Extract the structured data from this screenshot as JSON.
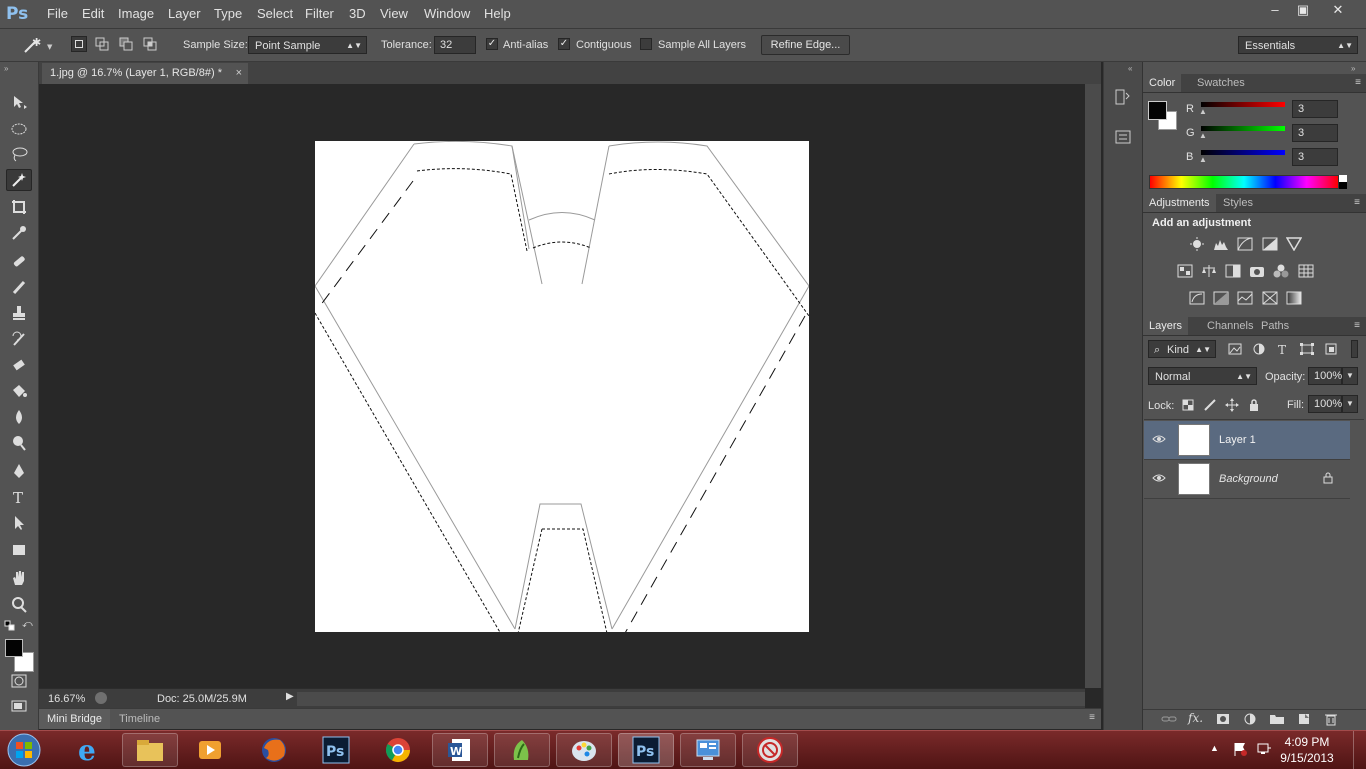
{
  "app": {
    "logo": "Ps"
  },
  "menu": {
    "items": [
      "File",
      "Edit",
      "Image",
      "Layer",
      "Type",
      "Select",
      "Filter",
      "3D",
      "View",
      "Window",
      "Help"
    ]
  },
  "window_controls": {
    "minimize": "–",
    "maximize": "▣",
    "close": "✕"
  },
  "options_bar": {
    "sample_size_label": "Sample Size:",
    "sample_size_value": "Point Sample",
    "tolerance_label": "Tolerance:",
    "tolerance_value": "32",
    "anti_alias_label": "Anti-alias",
    "anti_alias_checked": true,
    "contiguous_label": "Contiguous",
    "contiguous_checked": true,
    "sample_all_layers_label": "Sample All Layers",
    "sample_all_layers_checked": false,
    "refine_edge_label": "Refine Edge...",
    "workspace_value": "Essentials"
  },
  "document": {
    "tab_title": "1.jpg @ 16.7% (Layer 1, RGB/8#) *",
    "tab_close": "×"
  },
  "status_bar": {
    "zoom": "16.67%",
    "doc_info": "Doc: 25.0M/25.9M"
  },
  "bottom_tabs": [
    "Mini Bridge",
    "Timeline"
  ],
  "color_panel": {
    "tabs": [
      "Color",
      "Swatches"
    ],
    "channels": [
      {
        "label": "R",
        "value": "3"
      },
      {
        "label": "G",
        "value": "3"
      },
      {
        "label": "B",
        "value": "3"
      }
    ],
    "foreground": "#030303",
    "background": "#ffffff"
  },
  "adjustments_panel": {
    "tabs": [
      "Adjustments",
      "Styles"
    ],
    "heading": "Add an adjustment"
  },
  "layers_panel": {
    "tabs": [
      "Layers",
      "Channels",
      "Paths"
    ],
    "filter_kind": "Kind",
    "blend_mode": "Normal",
    "opacity_label": "Opacity:",
    "opacity_value": "100%",
    "lock_label": "Lock:",
    "fill_label": "Fill:",
    "fill_value": "100%",
    "layers": [
      {
        "name": "Layer 1",
        "selected": true
      },
      {
        "name": "Background",
        "selected": false,
        "locked": true
      }
    ]
  },
  "taskbar": {
    "time": "4:09 PM",
    "date": "9/15/2013"
  },
  "colors": {
    "ui_dark": "#535353",
    "canvas_bg": "#282828",
    "selected_layer": "#5a6a80",
    "taskbar": "#6b2020"
  }
}
